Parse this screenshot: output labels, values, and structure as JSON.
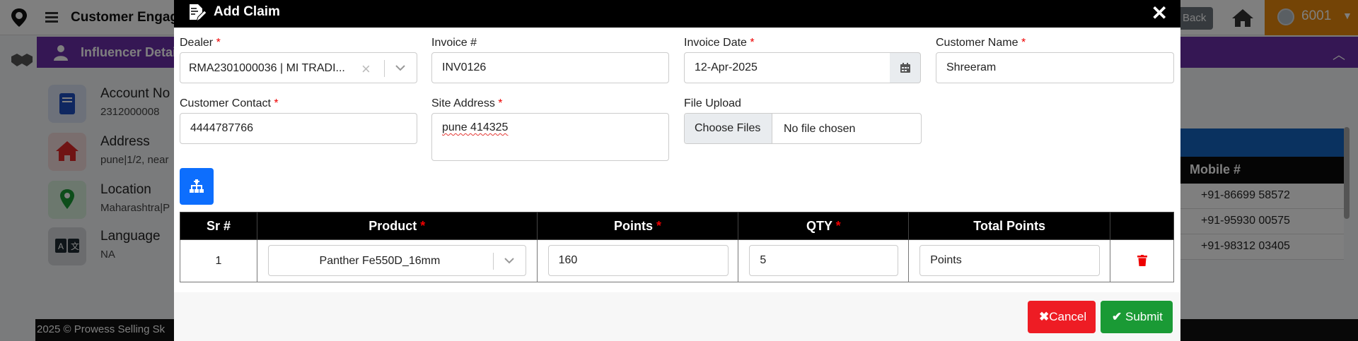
{
  "app": {
    "title": "Customer Engage",
    "back_label": "Back",
    "user_id": "6001",
    "panel_title": "Influencer Detail",
    "footer_text": "2025 © Prowess Selling Sk",
    "cards": [
      {
        "label": "Account No",
        "value": "2312000008",
        "icon": "book-icon",
        "color": "#1e4fc0"
      },
      {
        "label": "Address",
        "value": "pune|1/2, near",
        "icon": "home-icon",
        "color": "#e02828"
      },
      {
        "label": "Location",
        "value": "Maharashtra|P",
        "icon": "map-pin-icon",
        "color": "#1a9a35"
      },
      {
        "label": "Language",
        "value": "NA",
        "icon": "translate-icon",
        "color": "#1f2a33"
      }
    ],
    "side_table": {
      "header": "Mobile #",
      "rows": [
        "+91-86699 58572",
        "+91-95930 00575",
        "+91-98312 03405"
      ]
    }
  },
  "modal": {
    "title": "Add Claim",
    "fields": {
      "dealer": {
        "label": "Dealer",
        "value": "RMA2301000036 | MI TRADI..."
      },
      "invoice_no": {
        "label": "Invoice #",
        "value": "INV0126"
      },
      "invoice_date": {
        "label": "Invoice Date",
        "value": "12-Apr-2025"
      },
      "customer_name": {
        "label": "Customer Name",
        "value": "Shreeram"
      },
      "customer_contact": {
        "label": "Customer Contact",
        "value": "4444787766"
      },
      "site_address": {
        "label": "Site Address",
        "value": "pune 414325"
      },
      "file_upload": {
        "label": "File Upload",
        "button": "Choose Files",
        "status": "No file chosen"
      }
    },
    "table": {
      "headers": [
        "Sr #",
        "Product",
        "Points",
        "QTY",
        "Total Points",
        ""
      ],
      "required": [
        false,
        true,
        true,
        true,
        false,
        false
      ],
      "rows": [
        {
          "sr": "1",
          "product": "Panther Fe550D_16mm",
          "points": "160",
          "qty": "5",
          "total_placeholder": "Points"
        }
      ]
    },
    "buttons": {
      "cancel": "Cancel",
      "submit": "Submit"
    }
  }
}
